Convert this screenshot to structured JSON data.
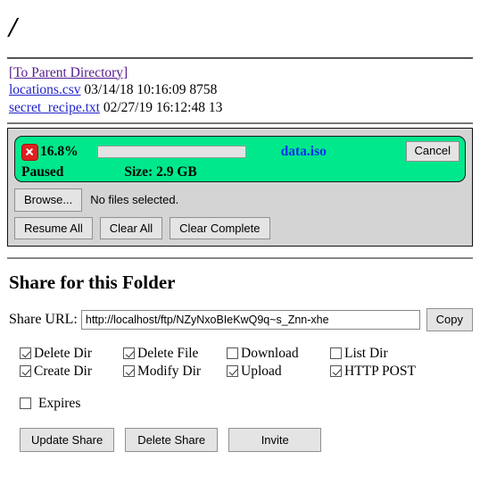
{
  "page": {
    "title": "/"
  },
  "listing": {
    "parent_link": "[To Parent Directory]",
    "files": [
      {
        "name": "locations.csv",
        "date": "03/14/18",
        "time": "10:16:09",
        "size": "8758"
      },
      {
        "name": "secret_recipe.txt",
        "date": "02/27/19",
        "time": "16:12:48",
        "size": "13"
      }
    ]
  },
  "upload": {
    "progress": {
      "cancel_icon": "close-x-icon",
      "percent_label": "16.8%",
      "percent_value": 16.8,
      "filename": "data.iso",
      "cancel_label": "Cancel",
      "status": "Paused",
      "size_label": "Size: 2.9 GB",
      "panel_color": "#00e88c",
      "bar_fill_color": "#2fba3e",
      "filename_color": "#0b30f0"
    },
    "browse_label": "Browse...",
    "no_files_text": "No files selected.",
    "buttons": [
      "Resume All",
      "Clear All",
      "Clear Complete"
    ]
  },
  "share": {
    "heading": "Share for this Folder",
    "url_label": "Share URL:",
    "url_value": "http://localhost/ftp/NZyNxoBIeKwQ9q~s_Znn-xhe",
    "copy_label": "Copy",
    "permissions": [
      {
        "label": "Delete Dir",
        "checked": true
      },
      {
        "label": "Delete File",
        "checked": true
      },
      {
        "label": "Download",
        "checked": false
      },
      {
        "label": "List Dir",
        "checked": false
      },
      {
        "label": "Create Dir",
        "checked": true
      },
      {
        "label": "Modify Dir",
        "checked": true
      },
      {
        "label": "Upload",
        "checked": true
      },
      {
        "label": "HTTP POST",
        "checked": true
      }
    ],
    "expires": {
      "label": "Expires",
      "checked": false
    },
    "actions": [
      "Update Share",
      "Delete Share",
      "Invite"
    ]
  }
}
